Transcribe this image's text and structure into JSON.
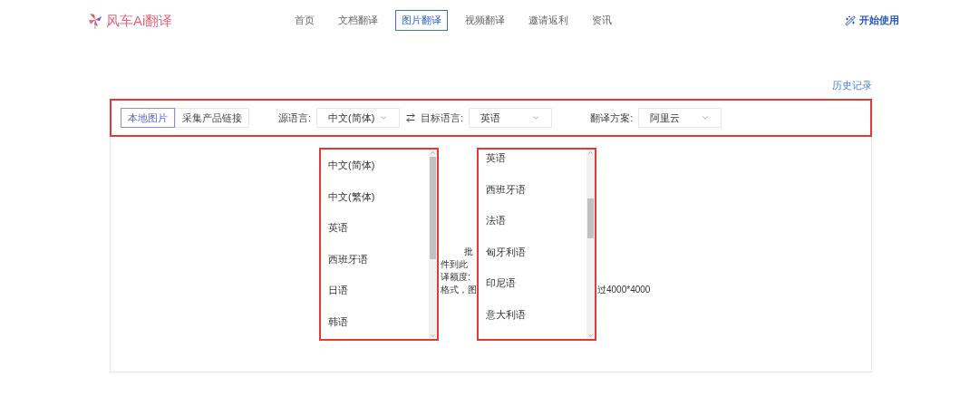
{
  "logo": {
    "text": "风车Ai翻译"
  },
  "nav": [
    {
      "label": "首页",
      "selected": false
    },
    {
      "label": "文档翻译",
      "selected": false
    },
    {
      "label": "图片翻译",
      "selected": true
    },
    {
      "label": "视频翻译",
      "selected": false
    },
    {
      "label": "邀请返利",
      "selected": false
    },
    {
      "label": "资讯",
      "selected": false
    }
  ],
  "start_button": "开始使用",
  "history_link": "历史记录",
  "toolbar": {
    "source_tabs": [
      {
        "label": "本地图片",
        "selected": true
      },
      {
        "label": "采集产品链接",
        "selected": false
      }
    ],
    "source_language": {
      "label": "源语言:",
      "value": "中文(简体)"
    },
    "target_language": {
      "label": "目标语言:",
      "value": "英语"
    },
    "scheme": {
      "label": "翻译方案:",
      "value": "阿里云"
    }
  },
  "dropdowns": [
    {
      "options": [
        "中文(简体)",
        "中文(繁体)",
        "英语",
        "西班牙语",
        "日语",
        "韩语"
      ]
    },
    {
      "options": [
        "英语",
        "西班牙语",
        "法语",
        "匈牙利语",
        "印尼语",
        "意大利语"
      ]
    }
  ],
  "upload_hint_fragments": [
    "批",
    "件到此",
    "译额度:",
    "格式，图"
  ],
  "upload_hint_tail": "过4000*4000"
}
